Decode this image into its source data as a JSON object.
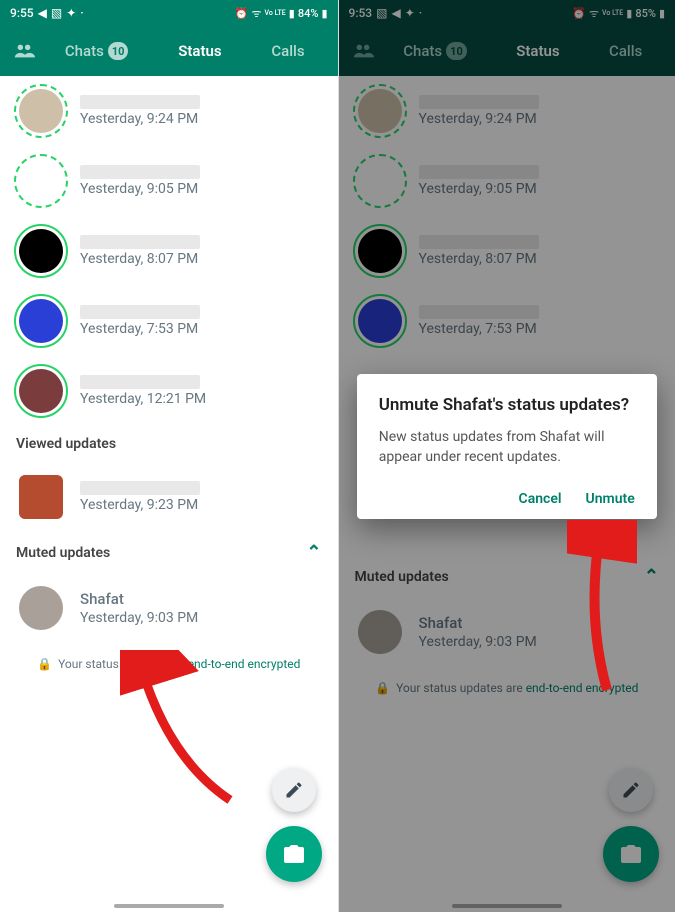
{
  "left": {
    "status": {
      "time": "9:55",
      "battery": "84%",
      "lte": "Vo LTE"
    },
    "tabs": {
      "chats": "Chats",
      "badge": "10",
      "status": "Status",
      "calls": "Calls"
    },
    "items": [
      {
        "time": "Yesterday, 9:24 PM",
        "ring": "dashed",
        "inner": "#cdbfa8"
      },
      {
        "time": "Yesterday, 9:05 PM",
        "ring": "dashed",
        "inner": "#ffffff"
      },
      {
        "time": "Yesterday, 8:07 PM",
        "ring": "ring",
        "inner": "#000000"
      },
      {
        "time": "Yesterday, 7:53 PM",
        "ring": "ring",
        "inner": "#2a3fd6"
      },
      {
        "time": "Yesterday, 12:21 PM",
        "ring": "ring",
        "inner": "#7a3c3c"
      }
    ],
    "viewed_header": "Viewed updates",
    "viewed": {
      "time": "Yesterday, 9:23 PM",
      "inner": "#b54c2f"
    },
    "muted_header": "Muted updates",
    "muted": {
      "name": "Shafat",
      "time": "Yesterday, 9:03 PM",
      "inner": "#a8a099"
    },
    "enc": {
      "prefix": "Your status updates are ",
      "link": "end-to-end encrypted"
    }
  },
  "right": {
    "status": {
      "time": "9:53",
      "battery": "85%",
      "lte": "Vo LTE"
    },
    "tabs": {
      "chats": "Chats",
      "badge": "10",
      "status": "Status",
      "calls": "Calls"
    },
    "items": [
      {
        "time": "Yesterday, 9:24 PM",
        "ring": "dashed",
        "inner": "#cdbfa8"
      },
      {
        "time": "Yesterday, 9:05 PM",
        "ring": "dashed",
        "inner": "#ffffff"
      },
      {
        "time": "Yesterday, 8:07 PM",
        "ring": "ring",
        "inner": "#000000"
      },
      {
        "time": "Yesterday, 7:53 PM",
        "ring": "ring",
        "inner": "#2a3fd6"
      }
    ],
    "muted_header": "Muted updates",
    "muted": {
      "name": "Shafat",
      "time": "Yesterday, 9:03 PM",
      "inner": "#a8a099"
    },
    "enc": {
      "prefix": "Your status updates are ",
      "link": "end-to-end encrypted"
    },
    "dialog": {
      "title": "Unmute Shafat's status updates?",
      "body": "New status updates from Shafat will appear under recent updates.",
      "cancel": "Cancel",
      "confirm": "Unmute"
    }
  }
}
